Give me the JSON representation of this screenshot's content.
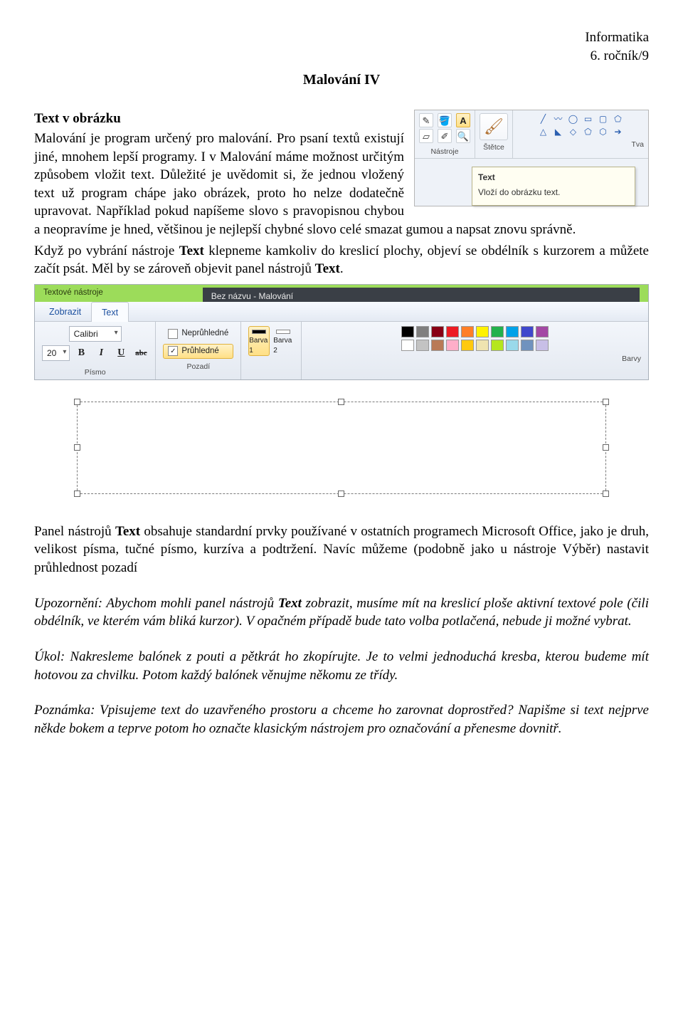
{
  "header": {
    "subject": "Informatika",
    "grade": "6. ročník/9"
  },
  "title": "Malování IV",
  "subheading": "Text v obrázku",
  "para1a": "Malování je program určený pro malování. Pro psaní textů existují jiné, mnohem lepší programy. I v Malování máme možnost určitým způsobem vložit text. Důležité je uvědomit si, že jednou vložený text už program chápe jako obrázek, proto ho nelze dodatečně upravovat. Například pokud napíšeme slovo s pravopisnou chybou a neopravíme je hned, většinou je nejlepší chybné slovo celé smazat gumou a napsat znovu správně.",
  "para1b_pre": "Když po vybrání nástroje ",
  "para1b_bold": "Text",
  "para1b_mid": " klepneme kamkoliv do kreslicí plochy, objeví se obdélník s kurzorem a můžete začít psát. Měl by se zároveň objevit panel nástrojů ",
  "para1b_bold2": "Text",
  "para1b_post": ".",
  "mini": {
    "tool_pencil_name": "pencil-icon",
    "tool_fill_name": "fill-icon",
    "tool_text_name": "text-icon",
    "tool_text_glyph": "A",
    "tool_eraser_name": "eraser-icon",
    "tool_picker_name": "picker-icon",
    "tool_zoom_name": "zoom-icon",
    "group_tools": "Nástroje",
    "brush_label": "Štětce",
    "tva": "Tva",
    "tooltip_title": "Text",
    "tooltip_body": "Vloží do obrázku text."
  },
  "ribbon": {
    "context_tab": "Textové nástroje",
    "window_title": "Bez názvu - Malování",
    "tab_view": "Zobrazit",
    "tab_text": "Text",
    "font_name": "Calibri",
    "font_size": "20",
    "btn_bold": "B",
    "btn_italic": "I",
    "btn_under": "U",
    "btn_strike": "abc",
    "group_font": "Písmo",
    "opt_opaque": "Neprůhledné",
    "opt_transparent": "Průhledné",
    "group_bg": "Pozadí",
    "color1": "Barva 1",
    "color2": "Barva 2",
    "group_colors": "Barvy",
    "palette": [
      "#000000",
      "#7f7f7f",
      "#880015",
      "#ed1c24",
      "#ff7f27",
      "#fff200",
      "#22b14c",
      "#00a2e8",
      "#3f48cc",
      "#a349a4",
      "#ffffff",
      "#c3c3c3",
      "#b97a57",
      "#ffaec9",
      "#ffc90e",
      "#efe4b0",
      "#b5e61d",
      "#99d9ea",
      "#7092be",
      "#c8bfe7"
    ],
    "swatch1": "#000000",
    "swatch2": "#ffffff"
  },
  "para2_pre": "Panel nástrojů ",
  "para2_bold": "Text",
  "para2_post": " obsahuje standardní prvky používané v ostatních programech Microsoft Office, jako je druh, velikost písma, tučné písmo, kurzíva a podtržení. Navíc můžeme (podobně jako u nástroje Výběr) nastavit průhlednost pozadí",
  "warn_pre": "Upozornění: Abychom mohli panel nástrojů ",
  "warn_bold": "Text",
  "warn_post": " zobrazit, musíme mít na kreslicí ploše aktivní textové pole (čili obdélník, ve kterém vám bliká kurzor). V opačném případě bude tato volba potlačená, nebude ji možné vybrat.",
  "task": "Úkol: Nakresleme balónek z pouti a pětkrát ho zkopírujte. Je to velmi jednoduchá kresba, kterou budeme mít hotovou za chvilku. Potom každý balónek věnujme někomu ze třídy.",
  "note": "Poznámka: Vpisujeme text do uzavřeného prostoru a chceme ho zarovnat doprostřed? Napišme si text nejprve někde bokem a teprve potom ho označte klasickým nástrojem pro označování a přenesme dovnitř."
}
